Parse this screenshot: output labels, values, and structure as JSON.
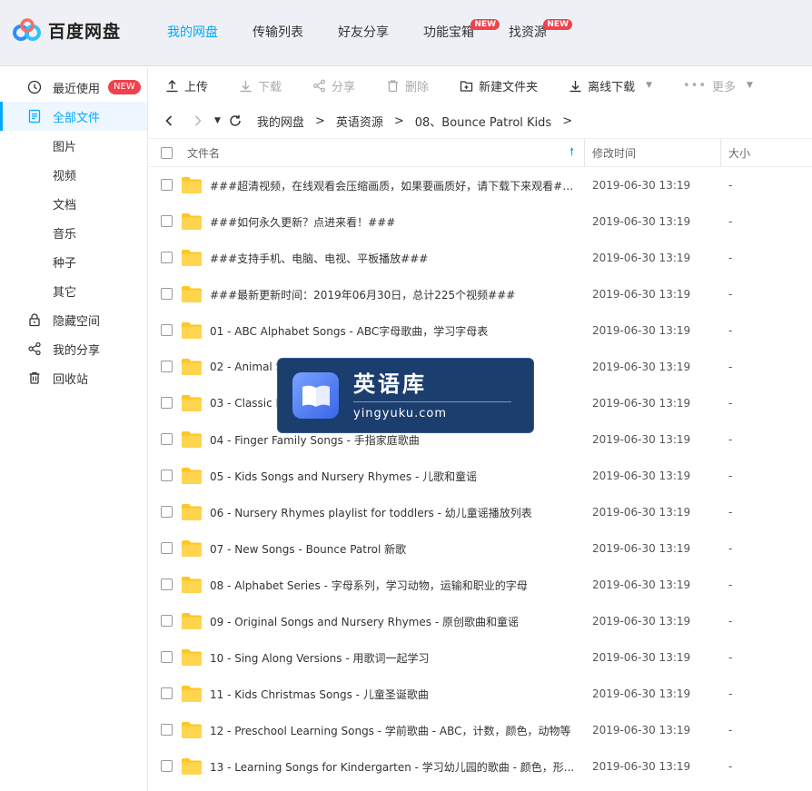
{
  "app": {
    "title": "百度网盘"
  },
  "topnav": [
    {
      "label": "我的网盘",
      "active": true,
      "badge": ""
    },
    {
      "label": "传输列表",
      "active": false,
      "badge": ""
    },
    {
      "label": "好友分享",
      "active": false,
      "badge": ""
    },
    {
      "label": "功能宝箱",
      "active": false,
      "badge": "NEW"
    },
    {
      "label": "找资源",
      "active": false,
      "badge": "NEW"
    }
  ],
  "sidebar": {
    "items": [
      {
        "label": "最近使用",
        "icon": "clock-icon",
        "badge": "NEW"
      },
      {
        "label": "全部文件",
        "icon": "file-icon",
        "active": true
      },
      {
        "label": "图片"
      },
      {
        "label": "视频"
      },
      {
        "label": "文档"
      },
      {
        "label": "音乐"
      },
      {
        "label": "种子"
      },
      {
        "label": "其它"
      },
      {
        "label": "隐藏空间",
        "icon": "lock-icon"
      },
      {
        "label": "我的分享",
        "icon": "share-icon"
      },
      {
        "label": "回收站",
        "icon": "trash-icon"
      }
    ]
  },
  "toolbar": {
    "upload": "上传",
    "download": "下载",
    "share": "分享",
    "delete": "删除",
    "new_folder": "新建文件夹",
    "offline_download": "离线下载",
    "more": "更多"
  },
  "breadcrumb": [
    "我的网盘",
    "英语资源",
    "08、Bounce Patrol Kids"
  ],
  "table": {
    "headers": {
      "name": "文件名",
      "modified": "修改时间",
      "size": "大小"
    },
    "rows": [
      {
        "name": "###超清视频，在线观看会压缩画质，如果要画质好，请下载下来观看###",
        "time": "2019-06-30 13:19",
        "size": "-"
      },
      {
        "name": "###如何永久更新？点进来看！###",
        "time": "2019-06-30 13:19",
        "size": "-"
      },
      {
        "name": "###支持手机、电脑、电视、平板播放###",
        "time": "2019-06-30 13:19",
        "size": "-"
      },
      {
        "name": "###最新更新时间：2019年06月30日，总计225个视频###",
        "time": "2019-06-30 13:19",
        "size": "-"
      },
      {
        "name": "01 - ABC Alphabet Songs - ABC字母歌曲，学习字母表",
        "time": "2019-06-30 13:19",
        "size": "-"
      },
      {
        "name": "02 - Animal S",
        "time": "2019-06-30 13:19",
        "size": "-"
      },
      {
        "name": "03 - Classic N",
        "time": "2019-06-30 13:19",
        "size": "-"
      },
      {
        "name": "04 - Finger Family Songs - 手指家庭歌曲",
        "time": "2019-06-30 13:19",
        "size": "-"
      },
      {
        "name": "05 - Kids Songs and Nursery Rhymes - 儿歌和童谣",
        "time": "2019-06-30 13:19",
        "size": "-"
      },
      {
        "name": "06 - Nursery Rhymes playlist for toddlers - 幼儿童谣播放列表",
        "time": "2019-06-30 13:19",
        "size": "-"
      },
      {
        "name": "07 - New Songs - Bounce Patrol 新歌",
        "time": "2019-06-30 13:19",
        "size": "-"
      },
      {
        "name": "08 - Alphabet Series - 字母系列，学习动物，运输和职业的字母",
        "time": "2019-06-30 13:19",
        "size": "-"
      },
      {
        "name": "09 - Original Songs and Nursery Rhymes - 原创歌曲和童谣",
        "time": "2019-06-30 13:19",
        "size": "-"
      },
      {
        "name": "10 - Sing Along Versions - 用歌词一起学习",
        "time": "2019-06-30 13:19",
        "size": "-"
      },
      {
        "name": "11 - Kids Christmas Songs - 儿童圣诞歌曲",
        "time": "2019-06-30 13:19",
        "size": "-"
      },
      {
        "name": "12 -  Preschool Learning Songs - 学前歌曲 - ABC，计数，颜色，动物等",
        "time": "2019-06-30 13:19",
        "size": "-"
      },
      {
        "name": "13 - Learning Songs for Kindergarten - 学习幼儿园的歌曲 - 颜色，形...",
        "time": "2019-06-30 13:19",
        "size": "-"
      }
    ]
  },
  "watermark": {
    "title": "英语库",
    "subtitle": "yingyuku.com"
  },
  "colors": {
    "accent": "#06a7ff",
    "badge": "#f0424d",
    "folder": "#ffc623"
  }
}
